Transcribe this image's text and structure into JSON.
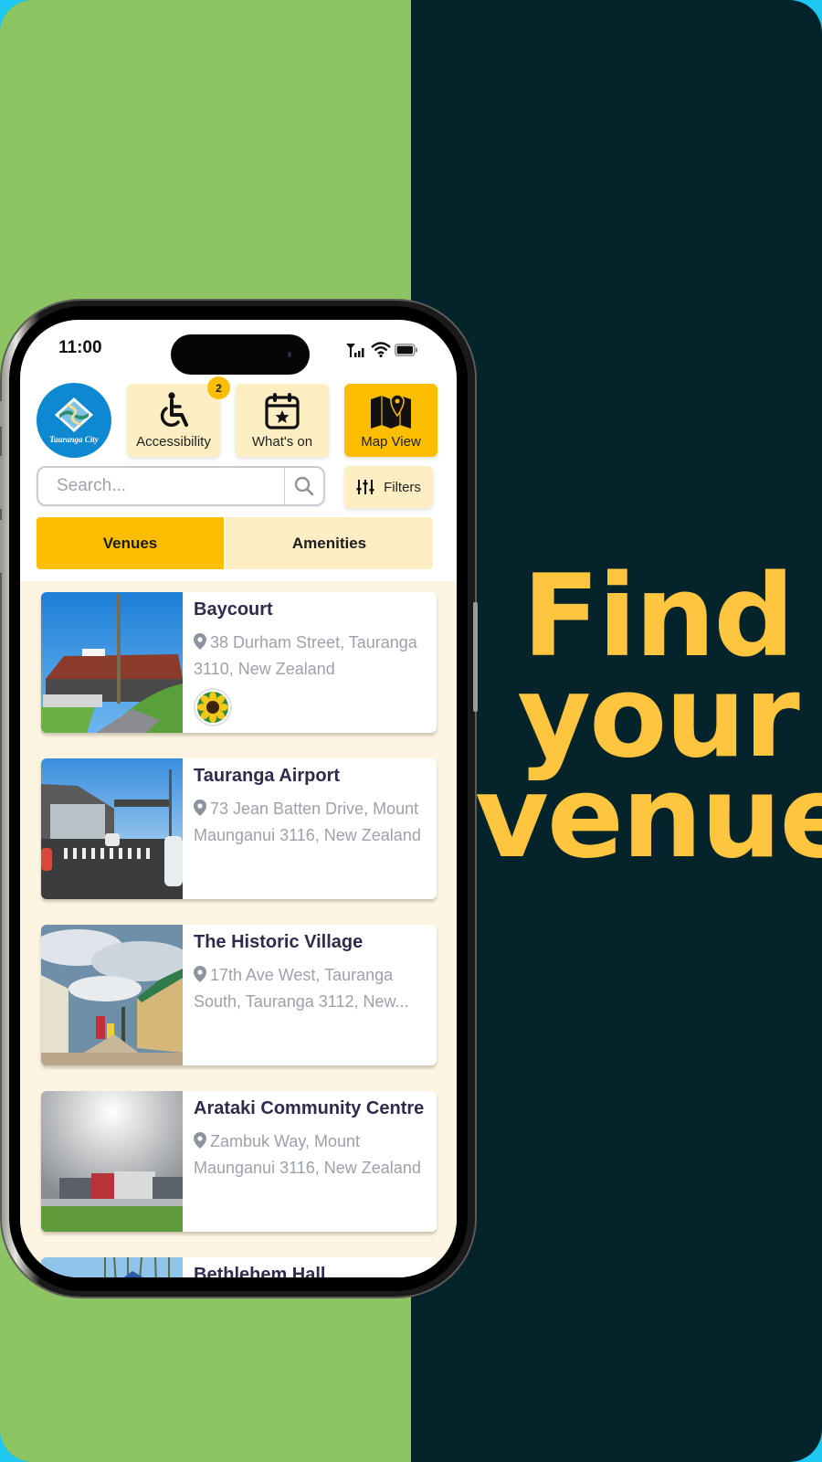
{
  "promo": {
    "headline_lines": [
      "Find",
      "your",
      "venue"
    ],
    "colors": {
      "left_background": "#8dc563",
      "right_background": "#05232a",
      "headline": "#fec53f"
    }
  },
  "status_bar": {
    "time": "11:00",
    "icons": [
      "signal-icon",
      "wifi-icon",
      "battery-icon"
    ]
  },
  "header": {
    "logo_text": "Tauranga City",
    "buttons": [
      {
        "label": "Accessibility",
        "icon": "wheelchair-icon",
        "badge": "2",
        "active": false
      },
      {
        "label": "What's on",
        "icon": "calendar-star-icon",
        "active": false
      },
      {
        "label": "Map View",
        "icon": "map-pin-icon",
        "active": true
      }
    ]
  },
  "search": {
    "placeholder": "Search...",
    "value": "",
    "filters_label": "Filters"
  },
  "tabs": [
    {
      "label": "Venues",
      "active": true
    },
    {
      "label": "Amenities",
      "active": false
    }
  ],
  "venues": [
    {
      "name": "Baycourt",
      "address": "38 Durham Street, Tauranga 3110, New Zealand",
      "badge": "sunflower-icon"
    },
    {
      "name": "Tauranga Airport",
      "address": "73 Jean Batten Drive, Mount Maunganui 3116, New Zealand"
    },
    {
      "name": "The Historic Village",
      "address": "17th Ave West, Tauranga South, Tauranga 3112, New..."
    },
    {
      "name": "Arataki Community Centre",
      "address": "Zambuk Way, Mount Maunganui 3116, New Zealand"
    },
    {
      "name": "Bethlehem Hall",
      "address": ""
    }
  ],
  "colors": {
    "accent": "#fdbe02",
    "accent_light": "#fdeec3",
    "list_background": "#fdf4e2",
    "title_text": "#2d2c4d",
    "address_text": "#9da1ab"
  }
}
